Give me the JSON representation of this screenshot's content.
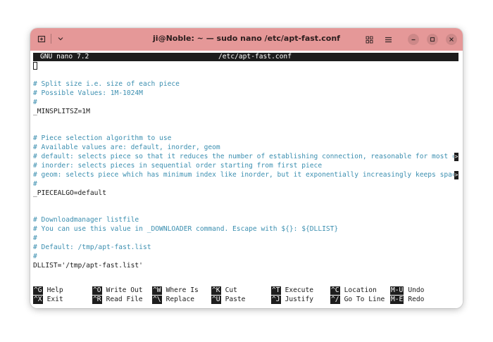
{
  "window": {
    "title": "ji@Noble: ~ — sudo nano /etc/apt-fast.conf"
  },
  "nano": {
    "version": "GNU nano 7.2",
    "filename": "/etc/apt-fast.conf"
  },
  "lines": [
    "# Split size i.e. size of each piece",
    "# Possible Values: 1M-1024M",
    "#",
    "_MINSPLITSZ=1M",
    "# Piece selection algorithm to use",
    "# Available values are: default, inorder, geom",
    "# default: selects piece so that it reduces the number of establishing connection, reasonable for most cas",
    "# inorder: selects pieces in sequential order starting from first piece",
    "# geom: selects piece which has minimum index like inorder, but it exponentially increasingly keeps space ",
    "#",
    "_PIECEALGO=default",
    "# Downloadmanager listfile",
    "# You can use this value in _DOWNLOADER command. Escape with ${}: ${DLLIST}",
    "#",
    "# Default: /tmp/apt-fast.list",
    "#",
    "DLLIST='/tmp/apt-fast.list'"
  ],
  "overflow_marker": ">",
  "shortcuts": [
    {
      "key": "^G",
      "label": "Help"
    },
    {
      "key": "^X",
      "label": "Exit"
    },
    {
      "key": "^O",
      "label": "Write Out"
    },
    {
      "key": "^R",
      "label": "Read File"
    },
    {
      "key": "^W",
      "label": "Where Is"
    },
    {
      "key": "^\\",
      "label": "Replace"
    },
    {
      "key": "^K",
      "label": "Cut"
    },
    {
      "key": "^U",
      "label": "Paste"
    },
    {
      "key": "^T",
      "label": "Execute"
    },
    {
      "key": "^J",
      "label": "Justify"
    },
    {
      "key": "^C",
      "label": "Location"
    },
    {
      "key": "^/",
      "label": "Go To Line"
    },
    {
      "key": "M-U",
      "label": "Undo"
    },
    {
      "key": "M-E",
      "label": "Redo"
    }
  ],
  "colors": {
    "titlebar": "#e59898",
    "comment": "#3c8fb0"
  }
}
